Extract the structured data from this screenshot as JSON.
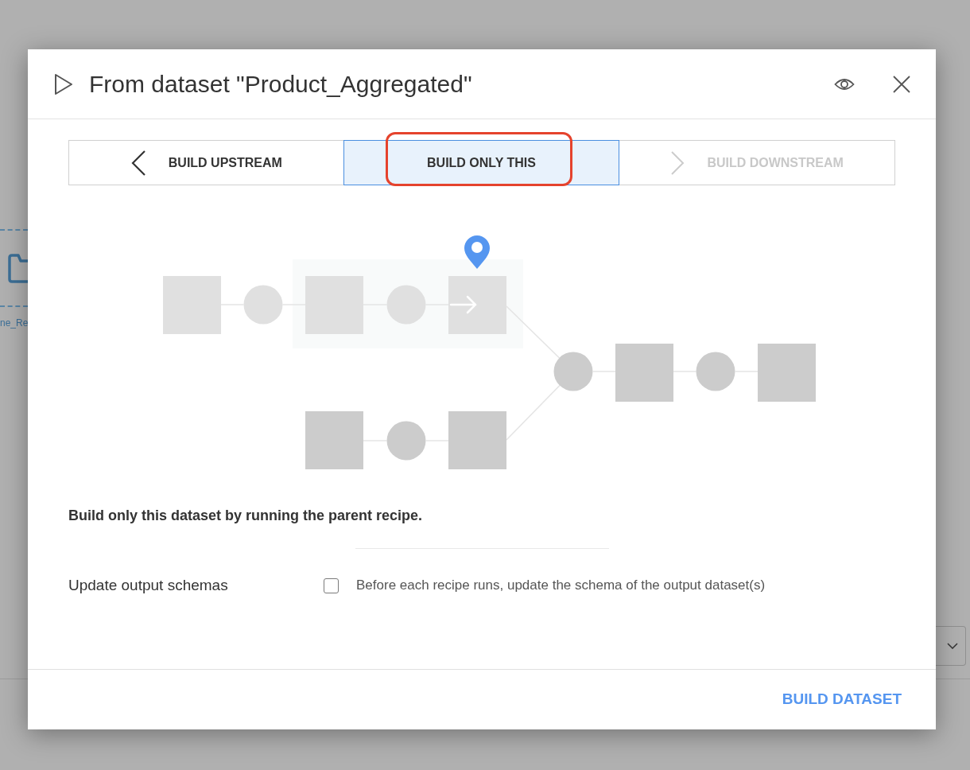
{
  "background": {
    "node_label": "ne_Re"
  },
  "dialog": {
    "title": "From dataset \"Product_Aggregated\"",
    "tabs": [
      {
        "label": "BUILD UPSTREAM",
        "kind": "upstream",
        "selected": false,
        "disabled": false,
        "highlighted": false
      },
      {
        "label": "BUILD ONLY THIS",
        "kind": "current",
        "selected": true,
        "disabled": false,
        "highlighted": true
      },
      {
        "label": "BUILD DOWNSTREAM",
        "kind": "downstream",
        "selected": false,
        "disabled": true,
        "highlighted": false
      }
    ],
    "description": "Build only this dataset by running the parent recipe.",
    "options": [
      {
        "label": "Update output schemas",
        "checked": false,
        "description": "Before each recipe runs, update the schema of the output dataset(s)"
      }
    ],
    "primary_button": "BUILD DATASET"
  }
}
